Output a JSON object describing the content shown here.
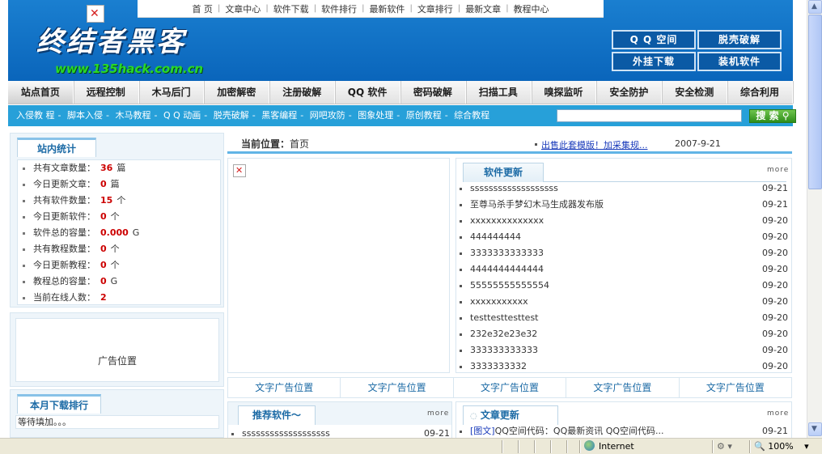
{
  "topnav": {
    "items": [
      "首 页",
      "文章中心",
      "软件下载",
      "软件排行",
      "最新软件",
      "文章排行",
      "最新文章",
      "教程中心"
    ]
  },
  "header": {
    "logo_text": "终结者黑客",
    "logo_url": "www.135hack.com.cn",
    "buttons": [
      "Q Q 空间",
      "脱壳破解",
      "外挂下载",
      "装机软件"
    ]
  },
  "mainnav": {
    "items": [
      "站点首页",
      "远程控制",
      "木马后门",
      "加密解密",
      "注册破解",
      "QQ 软件",
      "密码破解",
      "扫描工具",
      "嗅探监听",
      "安全防护",
      "安全检测",
      "综合利用"
    ]
  },
  "subnav": {
    "links": [
      "入侵教 程",
      "脚本入侵",
      "木马教程",
      "Q Q 动画",
      "脱壳破解",
      "黑客编程",
      "网吧攻防",
      "图象处理",
      "原创教程",
      "综合教程"
    ],
    "search_label": "搜 索"
  },
  "stats": {
    "title": "站内统计",
    "rows": [
      {
        "label": "共有文章数量：",
        "value": "36",
        "unit": "篇"
      },
      {
        "label": "今日更新文章：",
        "value": "0",
        "unit": "篇"
      },
      {
        "label": "共有软件数量：",
        "value": "15",
        "unit": "个"
      },
      {
        "label": "今日更新软件：",
        "value": "0",
        "unit": "个"
      },
      {
        "label": "软件总的容量：",
        "value": "0.000",
        "unit": "G"
      },
      {
        "label": "共有教程数量：",
        "value": "0",
        "unit": "个"
      },
      {
        "label": "今日更新教程：",
        "value": "0",
        "unit": "个"
      },
      {
        "label": "教程总的容量：",
        "value": "0",
        "unit": "G"
      },
      {
        "label": "当前在线人数：",
        "value": "2",
        "unit": ""
      }
    ]
  },
  "left_ad": {
    "label": "广告位置"
  },
  "monthly": {
    "title": "本月下载排行",
    "placeholder": "等待填加。。。"
  },
  "location": {
    "label": "当前位置：",
    "value": "首页",
    "notice": "出售此套模版！加采集规...",
    "notice_date": "2007-9-21"
  },
  "software_updates": {
    "title": "软件更新",
    "more": "more",
    "items": [
      {
        "title": "sssssssssssssssssss",
        "date": "09-21"
      },
      {
        "title": "至尊马杀手梦幻木马生成器发布版",
        "date": "09-21"
      },
      {
        "title": "xxxxxxxxxxxxxx",
        "date": "09-20"
      },
      {
        "title": "444444444",
        "date": "09-20"
      },
      {
        "title": "3333333333333",
        "date": "09-20"
      },
      {
        "title": "4444444444444",
        "date": "09-20"
      },
      {
        "title": "55555555555554",
        "date": "09-20"
      },
      {
        "title": "xxxxxxxxxxx",
        "date": "09-20"
      },
      {
        "title": "testtesttesttest",
        "date": "09-20"
      },
      {
        "title": "232e32e23e32",
        "date": "09-20"
      },
      {
        "title": "333333333333",
        "date": "09-20"
      },
      {
        "title": "3333333332",
        "date": "09-20"
      }
    ]
  },
  "text_ads": [
    "文字广告位置",
    "文字广告位置",
    "文字广告位置",
    "文字广告位置",
    "文字广告位置"
  ],
  "recommended": {
    "title": "推荐软件～",
    "more": "more",
    "items": [
      {
        "title": "sssssssssssssssssss",
        "date": "09-21"
      }
    ]
  },
  "article_updates": {
    "title": "文章更新",
    "more": "more",
    "items": [
      {
        "prefix": "[图文]",
        "title": "QQ空间代码：QQ最新资讯 QQ空间代码...",
        "date": "09-21"
      }
    ]
  },
  "statusbar": {
    "zone": "Internet",
    "zoom": "100%"
  }
}
